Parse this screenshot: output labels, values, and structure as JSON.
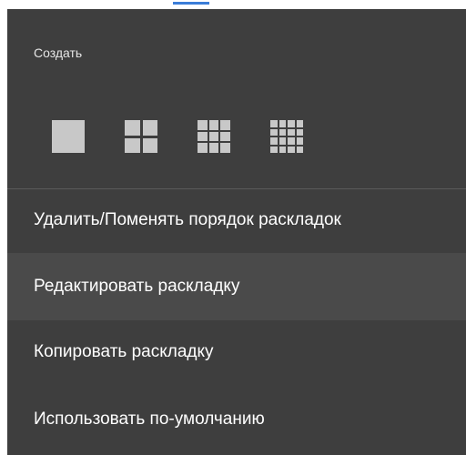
{
  "menu": {
    "section_title": "Создать",
    "layouts": [
      {
        "icon": "layout-1x1-icon"
      },
      {
        "icon": "layout-2x2-icon"
      },
      {
        "icon": "layout-3x3-icon"
      },
      {
        "icon": "layout-4x4-icon"
      }
    ],
    "items": [
      {
        "label": "Удалить/Поменять порядок раскладок"
      },
      {
        "label": "Редактировать раскладку",
        "highlighted": true
      },
      {
        "label": "Копировать раскладку"
      },
      {
        "label": "Использовать по-умолчанию"
      }
    ]
  },
  "colors": {
    "menu_background": "#3e3e3e",
    "highlight_background": "#4a4a4a",
    "icon_color": "#c8c8c8",
    "text_color": "#ffffff"
  }
}
